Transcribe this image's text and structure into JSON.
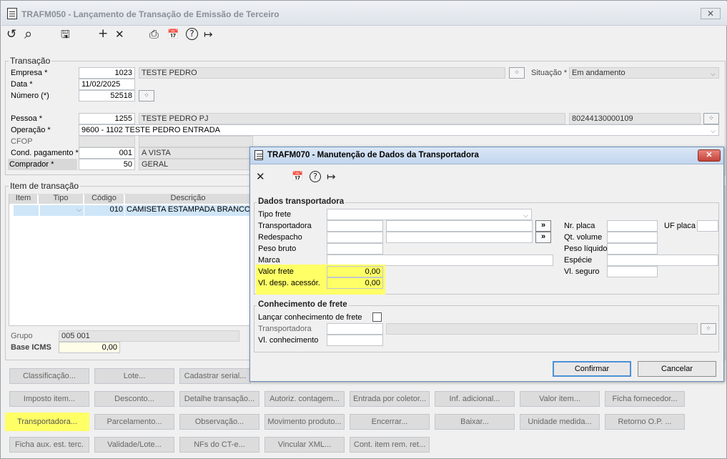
{
  "window": {
    "title": "TRAFM050 - Lançamento de Transação de Emissão de Terceiro",
    "close": "✕"
  },
  "toolbar": {
    "undo": "↺",
    "search": "⌕",
    "save": "🖫",
    "add": "+",
    "remove": "✕",
    "print": "⎙",
    "calendar": "📅",
    "help": "?",
    "exit": "↦"
  },
  "transacao": {
    "legend": "Transação",
    "empresa": {
      "label": "Empresa *",
      "code": "1023",
      "name": "TESTE PEDRO"
    },
    "situacao": {
      "label": "Situação *",
      "value": "Em andamento"
    },
    "data": {
      "label": "Data *",
      "value": "11/02/2025"
    },
    "numero": {
      "label": "Número (*)",
      "value": "52518"
    },
    "pessoa": {
      "label": "Pessoa *",
      "code": "1255",
      "name": "TESTE PEDRO PJ",
      "doc": "80244130000109"
    },
    "operacao": {
      "label": "Operação *",
      "value": "9600 - 1102 TESTE PEDRO ENTRADA"
    },
    "cfop": {
      "label": "CFOP"
    },
    "cond": {
      "label": "Cond. pagamento *",
      "code": "001",
      "name": "A VISTA"
    },
    "comprador": {
      "label": "Comprador *",
      "code": "50",
      "name": "GERAL"
    }
  },
  "item": {
    "legend": "Item de transação",
    "columns": [
      "Item",
      "Tipo",
      "Código",
      "Descrição"
    ],
    "row": {
      "codigo": "010",
      "descricao": "CAMISETA ESTAMPADA BRANCO P"
    },
    "grupo": {
      "label": "Grupo",
      "value": "005 001"
    },
    "base_icms": {
      "label": "Base ICMS",
      "value": "0,00"
    }
  },
  "buttons": [
    [
      "Classificação...",
      "Lote...",
      "Cadastrar serial..."
    ],
    [
      "Imposto item...",
      "Desconto...",
      "Detalhe transação...",
      "Autoriz. contagem...",
      "Entrada por coletor...",
      "Inf. adicional...",
      "Valor item...",
      "Ficha fornecedor..."
    ],
    [
      "Transportadora...",
      "Parcelamento...",
      "Observação...",
      "Movimento produto...",
      "Encerrar...",
      "Baixar...",
      "Unidade medida...",
      "Retorno O.P. ..."
    ],
    [
      "Ficha aux. est. terc.",
      "Validade/Lote...",
      "NFs do CT-e...",
      "Vincular XML...",
      "Cont. item rem. ret..."
    ]
  ],
  "modal": {
    "title": "TRAFM070 - Manutenção de Dados da Transportadora",
    "close": "✕",
    "dados": {
      "legend": "Dados transportadora",
      "tipo_frete": "Tipo frete",
      "transportadora": "Transportadora",
      "redespacho": "Redespacho",
      "peso_bruto": "Peso bruto",
      "marca": "Marca",
      "valor_frete": {
        "label": "Valor frete",
        "value": "0,00"
      },
      "vl_desp": {
        "label": "Vl. desp. acessór.",
        "value": "0,00"
      },
      "nr_placa": "Nr. placa",
      "uf_placa": "UF placa",
      "qt_volume": "Qt. volume",
      "peso_liquido": "Peso líquido",
      "especie": "Espécie",
      "vl_seguro": "Vl. seguro",
      "lookup": "»"
    },
    "conhecimento": {
      "legend": "Conhecimento de frete",
      "lancar": "Lançar conhecimento de frete",
      "transportadora": "Transportadora",
      "vl_conhecimento": "Vl. conhecimento"
    },
    "confirmar": "Confirmar",
    "cancelar": "Cancelar"
  }
}
